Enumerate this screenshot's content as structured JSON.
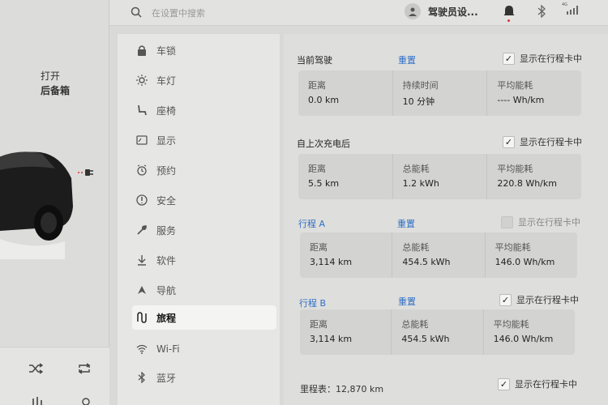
{
  "car": {
    "trunk_line1": "打开",
    "trunk_line2": "后备箱"
  },
  "topbar": {
    "search_placeholder": "在设置中搜索",
    "driver": "驾驶员设...",
    "signal_label": "4G",
    "icons": [
      "search-icon",
      "avatar-icon",
      "bell-icon",
      "bluetooth-icon",
      "signal-icon"
    ]
  },
  "menu": {
    "items": [
      {
        "label": "车锁",
        "icon": "lock-icon"
      },
      {
        "label": "车灯",
        "icon": "light-icon"
      },
      {
        "label": "座椅",
        "icon": "seat-icon"
      },
      {
        "label": "显示",
        "icon": "display-icon"
      },
      {
        "label": "预约",
        "icon": "schedule-icon"
      },
      {
        "label": "安全",
        "icon": "safety-icon"
      },
      {
        "label": "服务",
        "icon": "wrench-icon"
      },
      {
        "label": "软件",
        "icon": "download-icon"
      },
      {
        "label": "导航",
        "icon": "navigation-icon"
      },
      {
        "label": "旅程",
        "icon": "trips-icon"
      },
      {
        "label": "Wi-Fi",
        "icon": "wifi-icon"
      },
      {
        "label": "蓝牙",
        "icon": "bluetooth-icon"
      }
    ],
    "active_index": 9
  },
  "trips": {
    "show_label": "显示在行程卡中",
    "reset_label": "重置",
    "current": {
      "title": "当前驾驶",
      "checked": true,
      "stats": [
        {
          "k": "距离",
          "v": "0.0 km"
        },
        {
          "k": "持续时间",
          "v": "10 分钟"
        },
        {
          "k": "平均能耗",
          "v": "---- Wh/km"
        }
      ]
    },
    "since_charge": {
      "title": "自上次充电后",
      "checked": true,
      "stats": [
        {
          "k": "距离",
          "v": "5.5 km"
        },
        {
          "k": "总能耗",
          "v": "1.2 kWh"
        },
        {
          "k": "平均能耗",
          "v": "220.8 Wh/km"
        }
      ]
    },
    "trip_a": {
      "title": "行程 A",
      "checked": false,
      "stats": [
        {
          "k": "距离",
          "v": "3,114 km"
        },
        {
          "k": "总能耗",
          "v": "454.5 kWh"
        },
        {
          "k": "平均能耗",
          "v": "146.0 Wh/km"
        }
      ]
    },
    "trip_b": {
      "title": "行程 B",
      "checked": true,
      "stats": [
        {
          "k": "距离",
          "v": "3,114 km"
        },
        {
          "k": "总能耗",
          "v": "454.5 kWh"
        },
        {
          "k": "平均能耗",
          "v": "146.0 Wh/km"
        }
      ]
    },
    "odometer": "里程表：12,870 km",
    "odometer_checked": true
  },
  "colors": {
    "accent": "#2e6fc7",
    "notification": "#d33333"
  }
}
